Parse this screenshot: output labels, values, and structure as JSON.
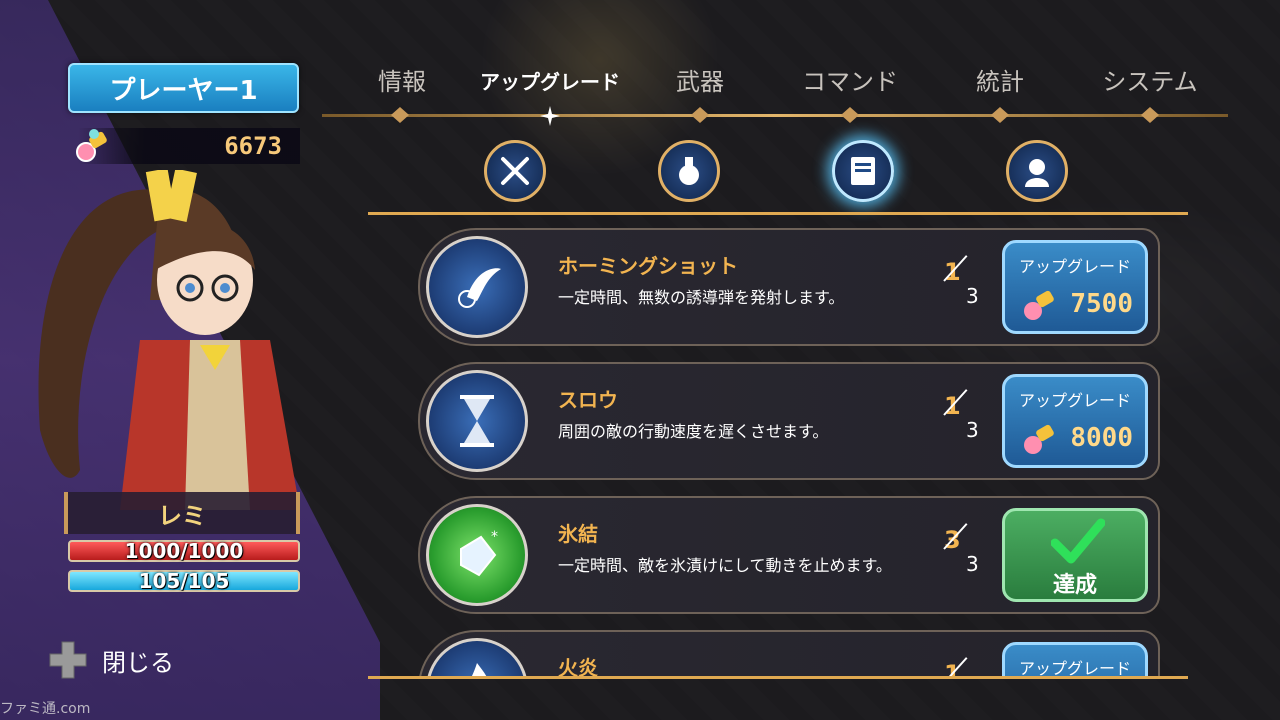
{
  "player": {
    "title": "プレーヤー1",
    "score": "6673"
  },
  "character": {
    "name": "レミ",
    "hp": "1000/1000",
    "mp": "105/105",
    "hp_fill": 1.0,
    "mp_fill": 1.0
  },
  "close": {
    "label": "閉じる"
  },
  "tabs": [
    {
      "label": "情報",
      "active": false
    },
    {
      "label": "アップグレード",
      "active": true
    },
    {
      "label": "武器",
      "active": false
    },
    {
      "label": "コマンド",
      "active": false
    },
    {
      "label": "統計",
      "active": false
    },
    {
      "label": "システム",
      "active": false
    }
  ],
  "categories": [
    {
      "icon": "crossed-swords-icon",
      "selected": false
    },
    {
      "icon": "potion-icon",
      "selected": false
    },
    {
      "icon": "book-icon",
      "selected": true
    },
    {
      "icon": "character-icon",
      "selected": false
    }
  ],
  "skills": [
    {
      "name": "ホーミングショット",
      "desc": "一定時間、無数の誘導弾を発射します。",
      "level": "1",
      "max": "3",
      "button": "アップグレード",
      "cost": "7500",
      "done": false,
      "icon": "homing-shot-icon"
    },
    {
      "name": "スロウ",
      "desc": "周囲の敵の行動速度を遅くさせます。",
      "level": "1",
      "max": "3",
      "button": "アップグレード",
      "cost": "8000",
      "done": false,
      "icon": "hourglass-icon"
    },
    {
      "name": "氷結",
      "desc": "一定時間、敵を氷漬けにして動きを止めます。",
      "level": "3",
      "max": "3",
      "button": "達成",
      "cost": "",
      "done": true,
      "icon": "ice-crystal-icon"
    },
    {
      "name": "火炎",
      "desc": "",
      "level": "1",
      "max": "",
      "button": "アップグレード",
      "cost": "",
      "done": false,
      "icon": "flame-icon"
    }
  ],
  "watermark": "ファミ通.com",
  "colors": {
    "accent_gold": "#f2b450",
    "tab_line": "#e3b66b",
    "upgrade_blue": "#2f7ab8",
    "done_green": "#3b9a52",
    "hp_red": "#d02a2a",
    "mp_cyan": "#3ec4ee"
  }
}
